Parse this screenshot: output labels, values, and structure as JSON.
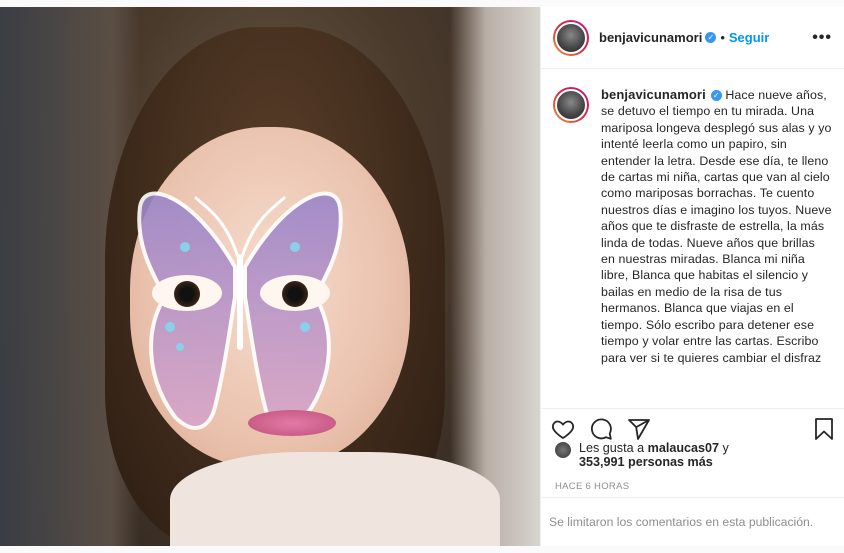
{
  "post": {
    "username": "benjavicunamori",
    "follow_label": "Seguir",
    "separator": "•",
    "more_label": "•••",
    "caption_username": "benjavicunamori",
    "caption_text": "Hace nueve años, se detuvo el tiempo en tu mirada. Una mariposa longeva desplegó sus alas y yo intenté leerla como un papiro, sin entender la letra. Desde ese día, te lleno de cartas mi niña, cartas que van al cielo como mariposas borrachas. Te cuento nuestros días e imagino los tuyos. Nueve años que te disfraste de estrella, la más linda de todas. Nueve años que brillas en nuestras miradas. Blanca mi niña libre, Blanca que habitas el silencio y bailas en medio de la risa de tus hermanos. Blanca que viajas en el tiempo. Sólo escribo para detener ese tiempo y volar entre las cartas. Escribo para ver si te quieres cambiar el disfraz",
    "likes_prefix": "Les gusta a",
    "likes_user": "malaucas07",
    "likes_conj": "y",
    "likes_count": "353,991 personas más",
    "timestamp": "HACE 6 HORAS",
    "comments_disabled": "Se limitaron los comentarios en esta publicación.",
    "icons": {
      "like": "heart-icon",
      "comment": "comment-icon",
      "share": "paper-plane-icon",
      "save": "bookmark-icon"
    }
  }
}
